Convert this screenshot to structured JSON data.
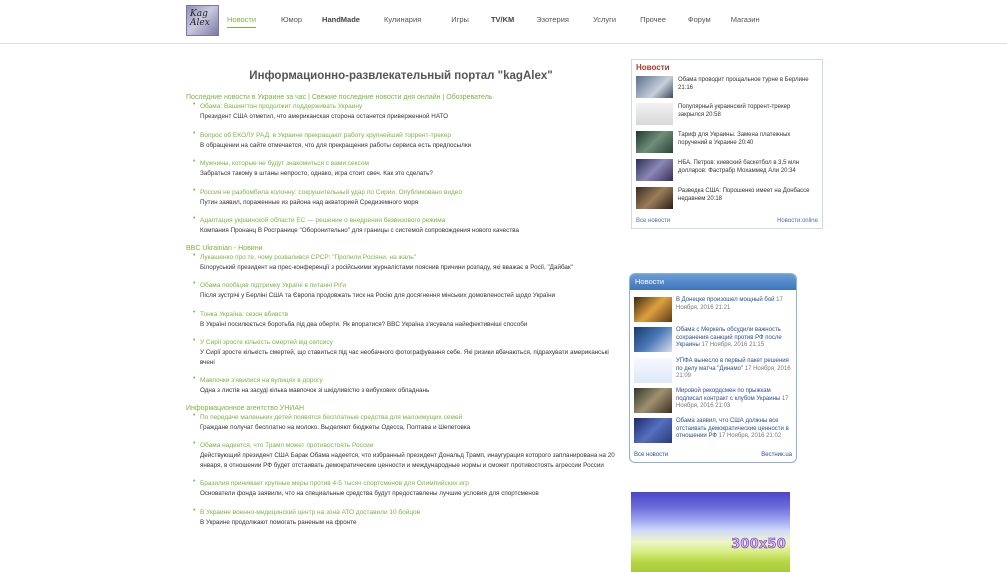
{
  "header": {
    "logo_text": "Kag Alex",
    "nav": [
      {
        "label": "Новости",
        "active": true
      },
      {
        "label": "Юмор"
      },
      {
        "label": "HandMade",
        "bold": true
      },
      {
        "label": "Кулинария"
      },
      {
        "label": "Игры"
      },
      {
        "label": "TV/KM",
        "bold": true
      },
      {
        "label": "Эзотерия"
      },
      {
        "label": "Услуги"
      },
      {
        "label": "Прочее"
      },
      {
        "label": "Форум"
      },
      {
        "label": "Магазин"
      }
    ]
  },
  "main": {
    "title": "Информационно-развлекательный портал \"kagAlex\"",
    "feeds": [
      {
        "title": "Последние новости в Украине за час | Свежие последние новости дня онлайн | Обозреватель",
        "items": [
          {
            "title": "Обама: Вашингтон продолжит поддерживать Украину",
            "desc": "Президент США отметил, что американская сторона останется приверженной НАТО"
          },
          {
            "title": "Вопрос об ЕКОЛУ РАД: в Украине прекращают работу крупнейший торрент-трекер",
            "desc": "В обращении на сайте отмечается, что для прекращения работы сервиса есть предпосылки"
          },
          {
            "title": "Мужчины, которые не будут знакомиться с вами сексом",
            "desc": "Забраться такому в штаны непросто, однако, игра стоит свеч. Как это сделать?"
          },
          {
            "title": "Россия не разбомбила колонну: сокрушительный удар по Сирии. Опубликовано видео",
            "desc": "Путин заявил, пораженные из района над акваторией Средиземного моря"
          },
          {
            "title": "Адаптация украинской области ЕС — решение о внедрении безвизового режима",
            "desc": "Компания Пронанц В Росгранице \"Оборонительно\" для границы с системой сопровождения нового качества"
          }
        ]
      },
      {
        "title": "BBC Ukrainian - Новини",
        "items": [
          {
            "title": "Лукашенко про те, чому розвалився СРСР: \"Пропили Росіяни, на жаль\"",
            "desc": "Білоруський президент на прес-конференції з російськими журналістами пояснив причини розпаду, які вважає в Росії, \"Дайбак\""
          },
          {
            "title": "Обама пообіцяв підтримку Україні в питанні Ріґи",
            "desc": "Після зустрічі у Берліні США та Європа продовжать тиск на Росію для досягнення мінських домовленостей щодо України"
          },
          {
            "title": "Тонка Україна: сезон вбивств",
            "desc": "В Україні посилюється боротьба під два оберти. Як впоратися? BBC Україна з'ясувала найефективніші способи"
          },
          {
            "title": "У Сирії зросте кількість смертей від сепсису",
            "desc": "У Сирії зросте кількість смертей, що ставиться під час необачного фотографування себе. Які ризики вбачаються, підрахувати американські вчені"
          },
          {
            "title": "Мавпочки з'явилися на вулицях в дорогу",
            "desc": "Одна з листів на засуді кілька мавпочок зі шкідливістю з вибухових обладнань"
          }
        ]
      },
      {
        "title": "Информационное агентство УНИАН",
        "items": [
          {
            "title": "По передаче маленьких детей появятся бесплатные средства для малоимущих семей",
            "desc": "Граждане получат бесплатно на молоко. Выделяют бюджеты Одесса, Полтава и Шепетовка"
          },
          {
            "title": "Обама надеется, что Трамп может противостоять России",
            "desc": "Действующий президент США Барак Обама надеется, что избранный президент Дональд Трамп, инаугурация которого запланирована на 20 января, в отношении РФ будет отстаивать демократические ценности и международные нормы и сможет противостоять агрессии России"
          },
          {
            "title": "Бразилия принимает крупные меры против 4-5 тысяч спортсменов для Олимпийских игр",
            "desc": "Основатели фонда заявили, что на специальные средства будут предоставлены лучшие условия для спортсменов"
          },
          {
            "title": "В Украине военно-медицинский центр на зона АТО доставили 10 бойцов",
            "desc": "В Украине продолжают помогать раненым на фронте"
          }
        ]
      }
    ]
  },
  "widget1": {
    "title": "Новости",
    "items": [
      {
        "text": "Обама проводит прощальное турне в Берлине 21:16"
      },
      {
        "text": "Популярный украинский торрент-трекер закрылся 20:58"
      },
      {
        "text": "Тариф для Украины. Замена платежных поручений в Украине 20:40"
      },
      {
        "text": "НБА. Петров: киевский баскетбол в 3,5 млн долларов: Фастрабр Мохаммед Али 20:34"
      },
      {
        "text": "Разведка США: Порошенко имеет на Донбассе недавнем 20:18"
      }
    ],
    "footer_left": "Все новости",
    "footer_right": "Новости:online"
  },
  "widget2": {
    "title": "Новости",
    "items": [
      {
        "text": "В Донецке произошел мощный бой ",
        "date": "17 Ноября, 2016 21:21"
      },
      {
        "text": "Обама с Меркель обсудили важность сохранения санкций против РФ после Украины ",
        "date": "17 Ноября, 2016 21:15"
      },
      {
        "text": "УПФА вынесло в первый пакет решения по делу матча \"Динамо\" ",
        "date": "17 Ноября, 2016 21:09"
      },
      {
        "text": "Мировой рекордсмен по прыжкам подписал контракт с клубом Украины ",
        "date": "17 Ноября, 2016 21:03"
      },
      {
        "text": "Обама заявил, что США должны все отстаивать демократические ценности в отношении РФ ",
        "date": "17 Ноября, 2016 21:02"
      }
    ],
    "footer_left": "Все новости",
    "footer_right": "Вестник.ua"
  },
  "banner": {
    "label": "300x50"
  }
}
